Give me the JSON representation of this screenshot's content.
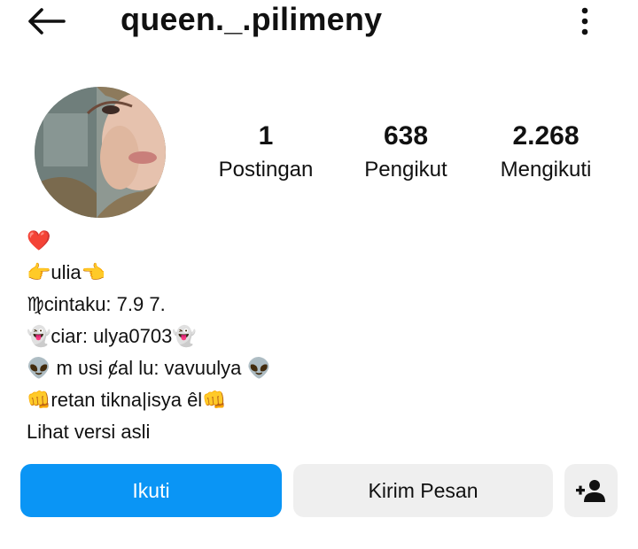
{
  "header": {
    "back_icon": "arrow-left-icon",
    "username": "queen._.pilimeny",
    "menu_icon": "more-vertical-icon"
  },
  "profile": {
    "avatar_icon": "profile-photo",
    "stats": [
      {
        "value": "1",
        "label": "Postingan"
      },
      {
        "value": "638",
        "label": "Pengikut"
      },
      {
        "value": "2.268",
        "label": "Mengikuti"
      }
    ]
  },
  "bio": {
    "lines": [
      "❤️",
      "👉ulia👈",
      "♍cintaku: 7.9 7.",
      "👻ciar: ulya0703👻",
      "👽 m ʋsi ȼal lu: vavuulya 👽",
      "👊retan tikna|isya êl👊"
    ],
    "see_original": "Lihat versi asli"
  },
  "actions": {
    "follow": "Ikuti",
    "message": "Kirim Pesan",
    "suggest_icon": "add-person-icon"
  },
  "colors": {
    "primary": "#0a95f5",
    "secondary_button": "#efefef",
    "text": "#111111"
  }
}
